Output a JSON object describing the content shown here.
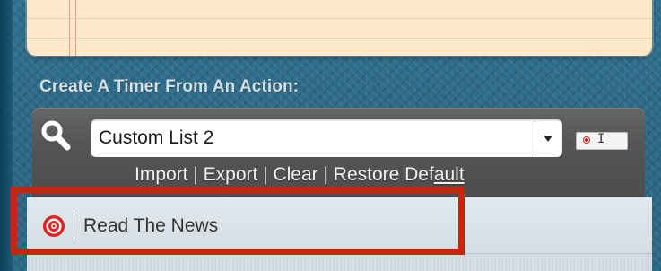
{
  "section_title": "Create A Timer From An Action:",
  "action_list_select": {
    "value": "Custom List 2",
    "options_visible": [
      "Custom List 2"
    ]
  },
  "links": {
    "import": "Import",
    "sep": " | ",
    "export": "Export",
    "clear": "Clear",
    "restore_prefix": "Restore Def",
    "restore_underlined": "ault"
  },
  "actions": [
    {
      "label": "Read The News",
      "icon": "target-icon"
    }
  ],
  "icons": {
    "search": "search-icon",
    "dropdown": "chevron-down-icon",
    "mini_chip": "target-icon"
  },
  "colors": {
    "highlight": "#c1280e",
    "panel": "#555555",
    "notepad": "#fde8c9",
    "target_red": "#e0241e"
  }
}
